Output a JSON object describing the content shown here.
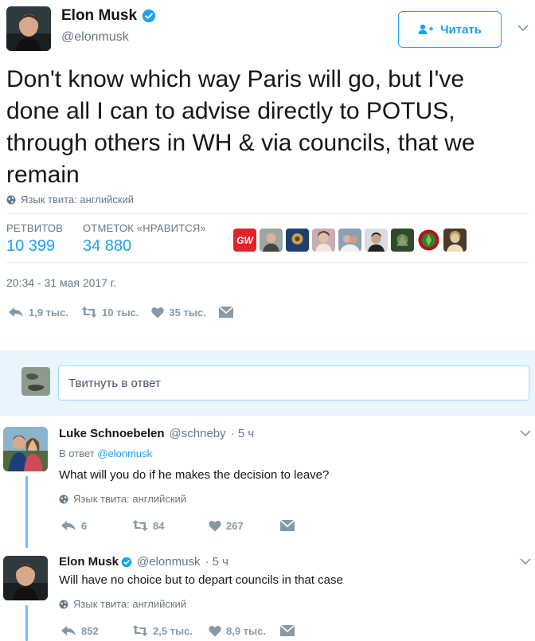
{
  "main_tweet": {
    "author_name": "Elon Musk",
    "author_handle": "@elonmusk",
    "follow_label": "Читать",
    "text": "Don't know which way Paris will go, but I've done all I can to advise directly to POTUS, through others in WH & via councils, that we remain",
    "language_label": "Язык твита: английский",
    "stats": {
      "retweets_label": "РЕТВИТОВ",
      "retweets_value": "10 399",
      "likes_label": "ОТМЕТОК «НРАВИТСЯ»",
      "likes_value": "34 880"
    },
    "liker_badge_text": "GW",
    "timestamp": "20:34 - 31 мая 2017 г.",
    "actions": {
      "replies": "1,9 тыс.",
      "retweets": "10 тыс.",
      "likes": "35 тыс."
    }
  },
  "reply_box": {
    "placeholder": "Твитнуть в ответ"
  },
  "replies": [
    {
      "author_name": "Luke Schnoebelen",
      "author_handle": "@schneby",
      "time": "· 5 ч",
      "reply_to_prefix": "В ответ",
      "reply_to_handle": "@elonmusk",
      "text": "What will you do if he makes the decision to leave?",
      "language_label": "Язык твита: английский",
      "actions": {
        "replies": "6",
        "retweets": "84",
        "likes": "267"
      }
    },
    {
      "author_name": "Elon Musk",
      "author_handle": "@elonmusk",
      "time": "· 5 ч",
      "text": "Will have no choice but to depart councils in that case",
      "language_label": "Язык твита: английский",
      "actions": {
        "replies": "852",
        "retweets": "2,5 тыс.",
        "likes": "8,9 тыс."
      }
    }
  ],
  "colors": {
    "accent": "#1da1f2",
    "muted": "#657786",
    "icon_gray": "#8899a6",
    "reply_bar_bg": "#e8f5fd",
    "thread_line": "#6bc3f0",
    "gw_badge": "#e0242b"
  }
}
